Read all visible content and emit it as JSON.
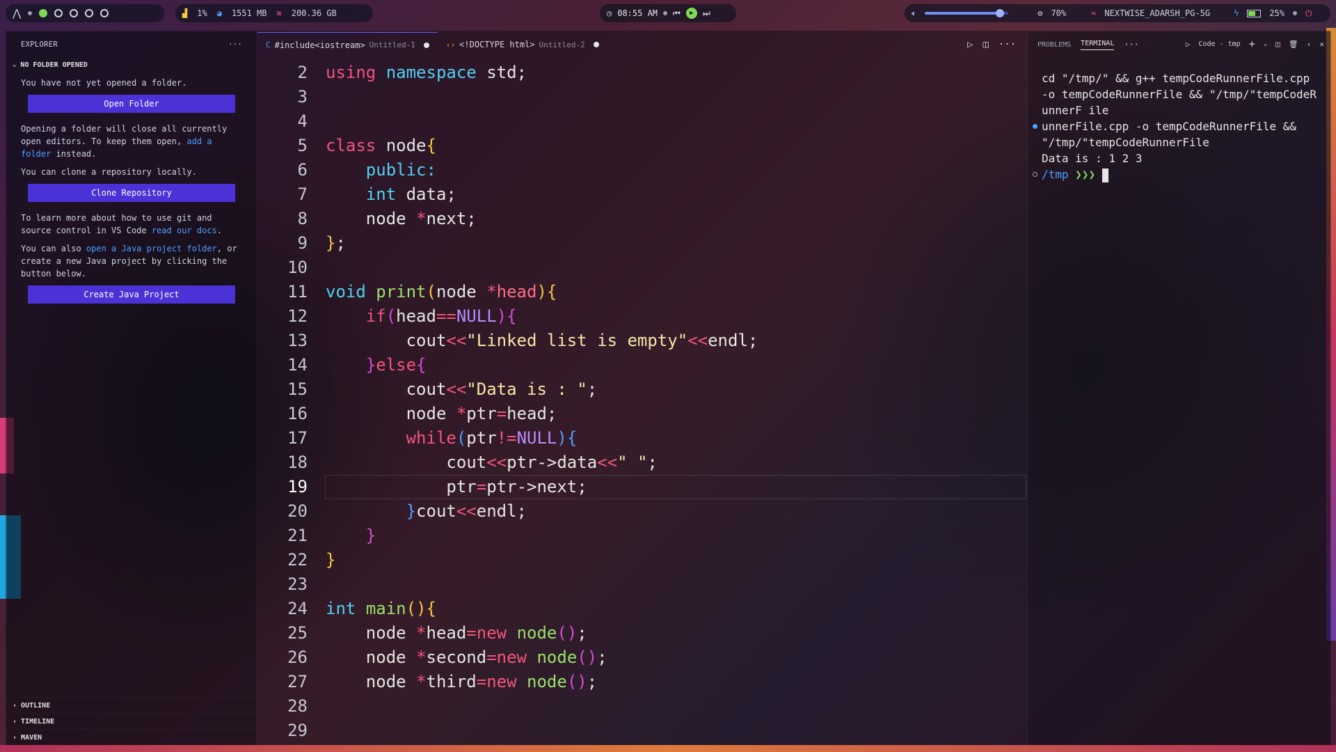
{
  "topbar": {
    "cpu": "1%",
    "memory": "1551 MB",
    "disk": "200.36 GB",
    "time": "08:55 AM",
    "volume_level": 0.9,
    "brightness": "70%",
    "wifi": "NEXTWISE_ADARSH_PG-5G",
    "battery": "25%"
  },
  "sidebar": {
    "title": "EXPLORER",
    "more": "···",
    "section": "NO FOLDER OPENED",
    "p1": "You have not yet opened a folder.",
    "open_folder": "Open Folder",
    "p2_a": "Opening a folder will close all currently open editors. To keep them open, ",
    "p2_link": "add a folder",
    "p2_b": " instead.",
    "p3": "You can clone a repository locally.",
    "clone_repo": "Clone Repository",
    "p4_a": "To learn more about how to use git and source control in VS Code ",
    "p4_link": "read our docs",
    "p4_b": ".",
    "p5_a": "You can also ",
    "p5_link": "open a Java project folder",
    "p5_b": ", or create a new Java project by clicking the button below.",
    "create_java": "Create Java Project",
    "bottom": [
      "OUTLINE",
      "TIMELINE",
      "MAVEN"
    ]
  },
  "tabs": [
    {
      "title": "#include<iostream>",
      "sub": "Untitled-1"
    },
    {
      "title": "<!DOCTYPE html>",
      "sub": "Untitled-2"
    }
  ],
  "code": {
    "line_numbers": [
      "2",
      "3",
      "4",
      "5",
      "6",
      "7",
      "8",
      "9",
      "10",
      "11",
      "12",
      "13",
      "14",
      "15",
      "16",
      "17",
      "18",
      "19",
      "20",
      "21",
      "22",
      "23",
      "24",
      "25",
      "26",
      "27",
      "28",
      "29"
    ],
    "current_line": "19",
    "t": {
      "using": "using",
      "namespace": "namespace",
      "std": " std;",
      "class": "class",
      "node_brace": " node",
      "lb": "{",
      "public": "public:",
      "int": "int",
      "data": " data;",
      "node": "node",
      "star": "*",
      "next": "next;",
      "rb": "}",
      "semi": ";",
      "void": "void",
      "print": "print",
      "lp": "(",
      "rp": ")",
      "head": "head",
      "if": "if",
      "eqeq": "==",
      "null": "NULL",
      "cout": "cout",
      "shl": "<<",
      "empty_str": "\"Linked list is empty\"",
      "endl": "endl;",
      "else": "else",
      "data_str": "\"Data is : \"",
      "ptr": "ptr",
      "eq": "=",
      "headsemi": "head;",
      "while": "while",
      "neq": "!=",
      "arrow_data": "->data",
      "space_str": "\" \"",
      "arrow_next": "->next;",
      "main": "main",
      "new": "new",
      "second": "second",
      "third": "third"
    }
  },
  "panel": {
    "tab_problems": "PROBLEMS",
    "tab_terminal": "TERMINAL",
    "more": "···",
    "term_name": "Code - tmp",
    "lines": [
      "cd \"/tmp/\" && g++ tempCodeRunnerFile.cpp -o tempCodeRunnerFile && \"/tmp/\"tempCodeRunnerF ile",
      "unnerFile.cpp -o tempCodeRunnerFile && \"/tmp/\"tempCodeRunnerFile",
      "Data is : 1 2 3"
    ],
    "prompt_path": "/tmp",
    "prompt_arrow": "❯❯❯"
  },
  "colors": {
    "accent_button": "#4b32d6",
    "keyword": "#f2557d",
    "type": "#4fd1f0",
    "function": "#9be06a",
    "string": "#f5e6a8"
  }
}
